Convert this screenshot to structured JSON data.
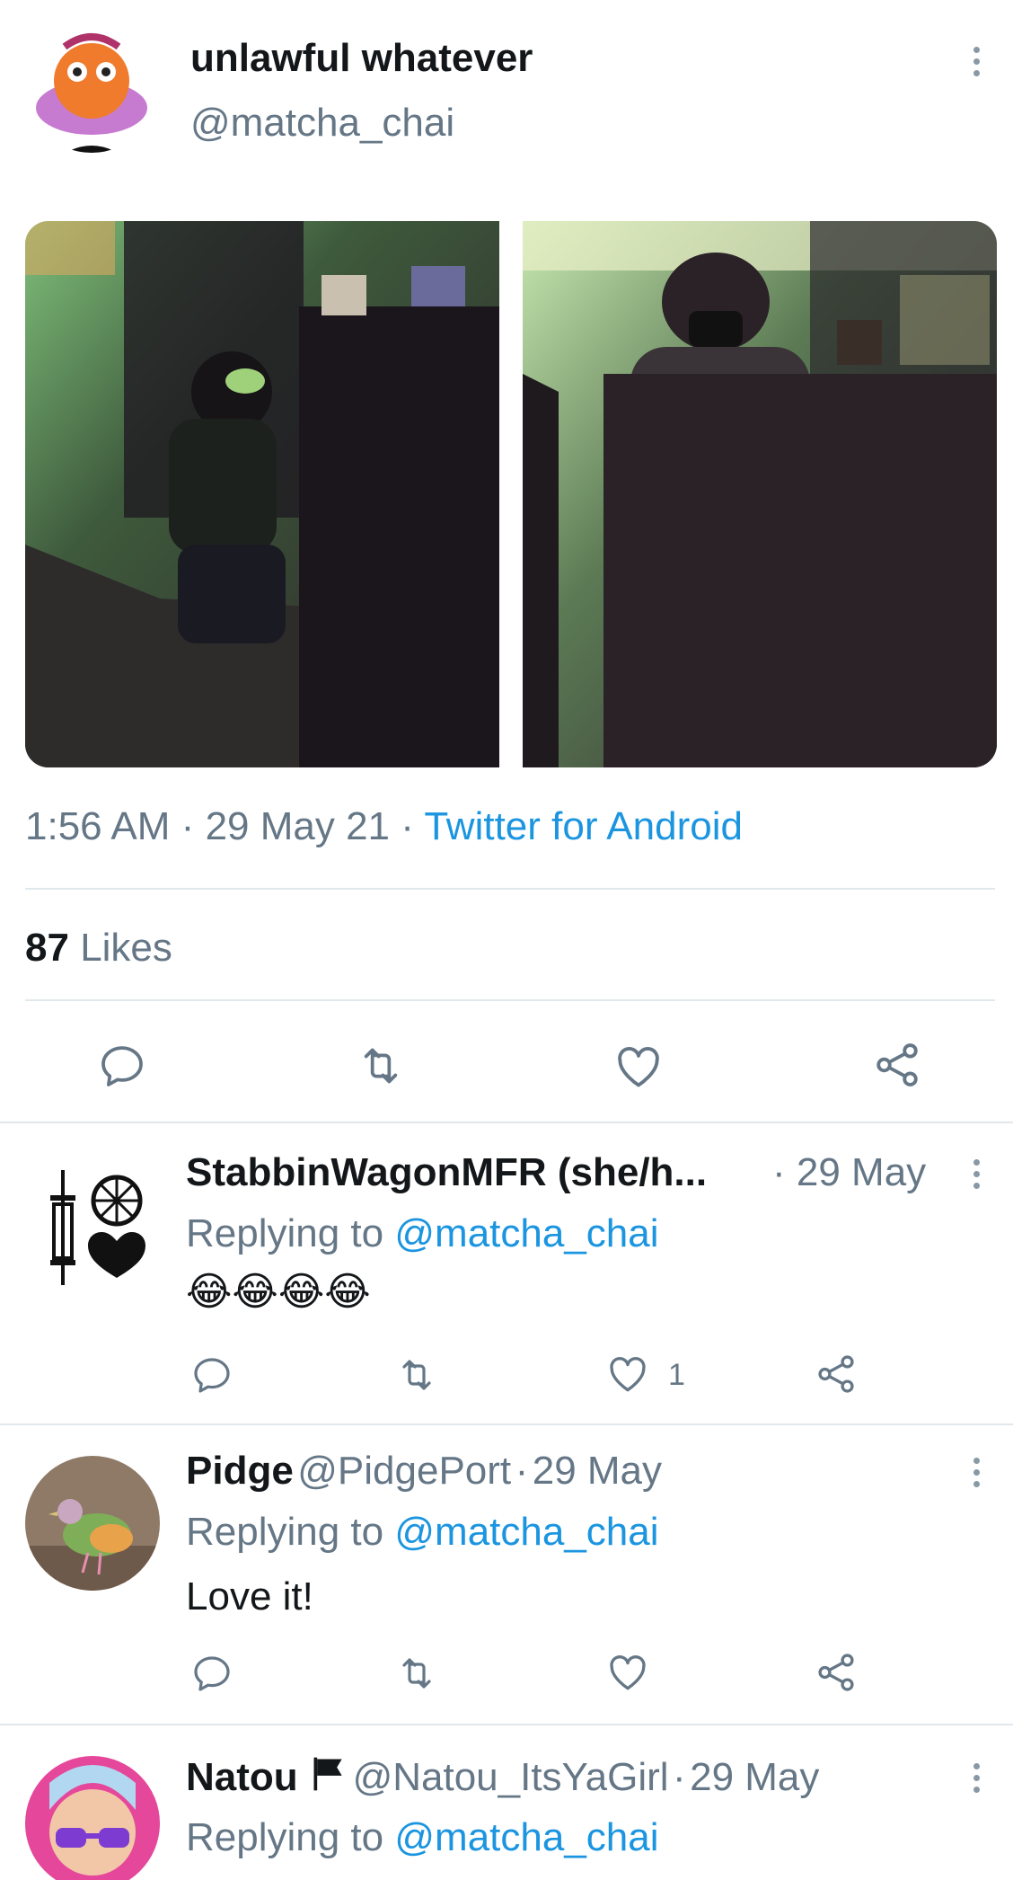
{
  "tweet": {
    "display_name": "unlawful whatever",
    "handle": "@matcha_chai",
    "time": "1:56 AM",
    "date": "29 May 21",
    "source": "Twitter for Android",
    "likes_count": "87",
    "likes_label": "Likes",
    "separator": "·"
  },
  "replies": [
    {
      "name": "StabbinWagonMFR (she/h...",
      "handle": "",
      "date": "29 May",
      "replying_prefix": "Replying to",
      "replying_to": "@matcha_chai",
      "text": "😂😂😂😂",
      "like_count": "1"
    },
    {
      "name": "Pidge",
      "handle": "@PidgePort",
      "date": "29 May",
      "replying_prefix": "Replying to",
      "replying_to": "@matcha_chai",
      "text": "Love it!",
      "like_count": ""
    },
    {
      "name": "Natou",
      "handle": "@Natou_ItsYaGirl",
      "date": "29 May",
      "replying_prefix": "Replying to",
      "replying_to": "@matcha_chai",
      "text": "",
      "like_count": ""
    }
  ],
  "icons": [
    "more-vertical-icon",
    "reply-icon",
    "retweet-icon",
    "like-icon",
    "share-icon",
    "flag-icon"
  ],
  "colors": {
    "text": "#14171a",
    "secondary": "#657786",
    "link": "#1b95e0",
    "divider": "#e1e8ed"
  }
}
